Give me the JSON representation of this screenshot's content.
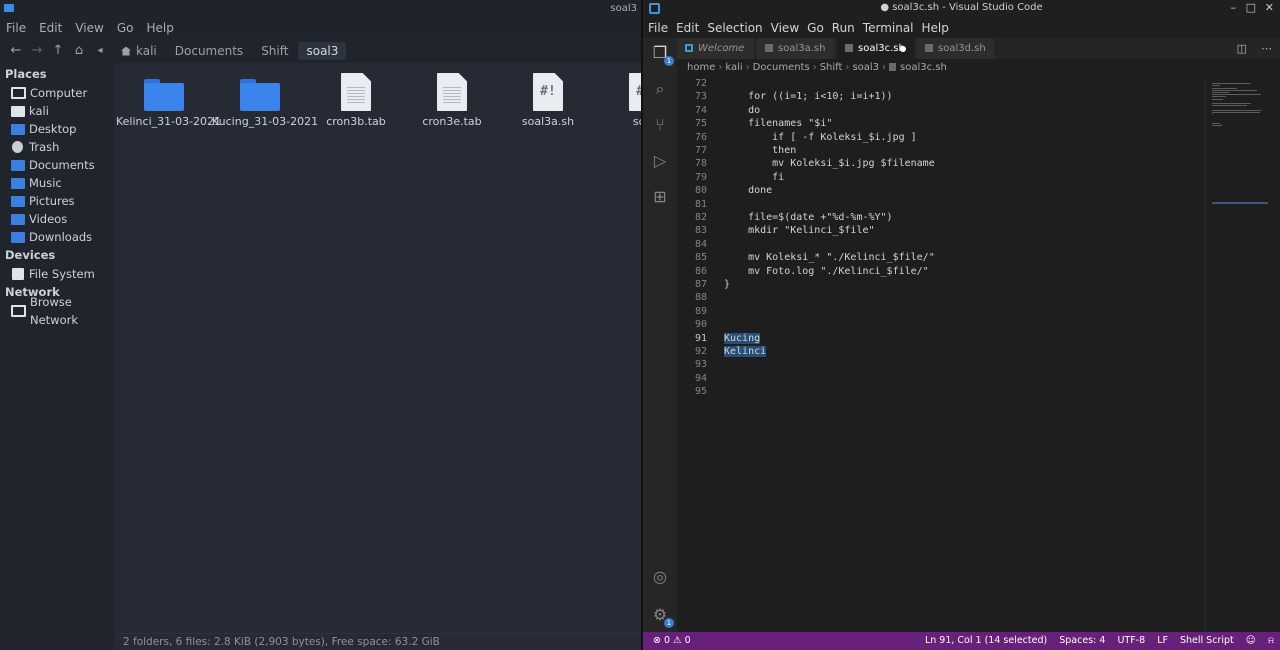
{
  "file_manager": {
    "title": "soal3",
    "menu": [
      "File",
      "Edit",
      "View",
      "Go",
      "Help"
    ],
    "breadcrumb": [
      "kali",
      "Documents",
      "Shift",
      "soal3"
    ],
    "sidebar": {
      "places_header": "Places",
      "places": [
        {
          "label": "Computer",
          "icon": "computer-icon"
        },
        {
          "label": "kali",
          "icon": "home-folder-icon"
        },
        {
          "label": "Desktop",
          "icon": "desktop-icon"
        },
        {
          "label": "Trash",
          "icon": "trash-icon"
        },
        {
          "label": "Documents",
          "icon": "documents-folder-icon"
        },
        {
          "label": "Music",
          "icon": "music-folder-icon"
        },
        {
          "label": "Pictures",
          "icon": "pictures-folder-icon"
        },
        {
          "label": "Videos",
          "icon": "videos-folder-icon"
        },
        {
          "label": "Downloads",
          "icon": "downloads-folder-icon"
        }
      ],
      "devices_header": "Devices",
      "devices": [
        {
          "label": "File System",
          "icon": "drive-icon"
        }
      ],
      "network_header": "Network",
      "network": [
        {
          "label": "Browse Network",
          "icon": "network-icon"
        }
      ]
    },
    "files": [
      {
        "name": "Kelinci_31-03-2021",
        "type": "folder"
      },
      {
        "name": "Kucing_31-03-2021",
        "type": "folder"
      },
      {
        "name": "cron3b.tab",
        "type": "text"
      },
      {
        "name": "cron3e.tab",
        "type": "text"
      },
      {
        "name": "soal3a.sh",
        "type": "script"
      },
      {
        "name": "soal",
        "type": "script"
      }
    ],
    "status": "2 folders, 6 files: 2.8 KiB (2,903 bytes), Free space: 63.2 GiB"
  },
  "vscode": {
    "title": "● soal3c.sh - Visual Studio Code",
    "menu": [
      "File",
      "Edit",
      "Selection",
      "View",
      "Go",
      "Run",
      "Terminal",
      "Help"
    ],
    "tabs": [
      {
        "label": "Welcome",
        "icon": "vscode-icon"
      },
      {
        "label": "soal3a.sh",
        "icon": "file-icon"
      },
      {
        "label": "soal3c.sh",
        "icon": "file-icon",
        "active": true,
        "modified": true
      },
      {
        "label": "soal3d.sh",
        "icon": "file-icon"
      }
    ],
    "breadcrumb": [
      "home",
      "kali",
      "Documents",
      "Shift",
      "soal3",
      "soal3c.sh"
    ],
    "code_lines": [
      {
        "num": "72",
        "text": ""
      },
      {
        "num": "73",
        "text": "    for ((i=1; i<10; i=i+1))"
      },
      {
        "num": "74",
        "text": "    do"
      },
      {
        "num": "75",
        "text": "    filenames \"$i\""
      },
      {
        "num": "76",
        "text": "        if [ -f Koleksi_$i.jpg ]"
      },
      {
        "num": "77",
        "text": "        then"
      },
      {
        "num": "78",
        "text": "        mv Koleksi_$i.jpg $filename"
      },
      {
        "num": "79",
        "text": "        fi"
      },
      {
        "num": "80",
        "text": "    done"
      },
      {
        "num": "81",
        "text": ""
      },
      {
        "num": "82",
        "text": "    file=$(date +\"%d-%m-%Y\")"
      },
      {
        "num": "83",
        "text": "    mkdir \"Kelinci_$file\""
      },
      {
        "num": "84",
        "text": ""
      },
      {
        "num": "85",
        "text": "    mv Koleksi_* \"./Kelinci_$file/\""
      },
      {
        "num": "86",
        "text": "    mv Foto.log \"./Kelinci_$file/\""
      },
      {
        "num": "87",
        "text": "}"
      },
      {
        "num": "88",
        "text": ""
      },
      {
        "num": "89",
        "text": ""
      },
      {
        "num": "90",
        "text": ""
      },
      {
        "num": "91",
        "text": "Kucing",
        "selected": true
      },
      {
        "num": "92",
        "text": "Kelinci",
        "selected": true
      },
      {
        "num": "93",
        "text": ""
      },
      {
        "num": "94",
        "text": ""
      },
      {
        "num": "95",
        "text": ""
      }
    ],
    "status": {
      "errors": "⊗ 0 ⚠ 0",
      "position": "Ln 91, Col 1 (14 selected)",
      "spaces": "Spaces: 4",
      "encoding": "UTF-8",
      "eol": "LF",
      "language": "Shell Script"
    },
    "colors": {
      "status_bar": "#68217a",
      "selection": "#264f78"
    }
  }
}
